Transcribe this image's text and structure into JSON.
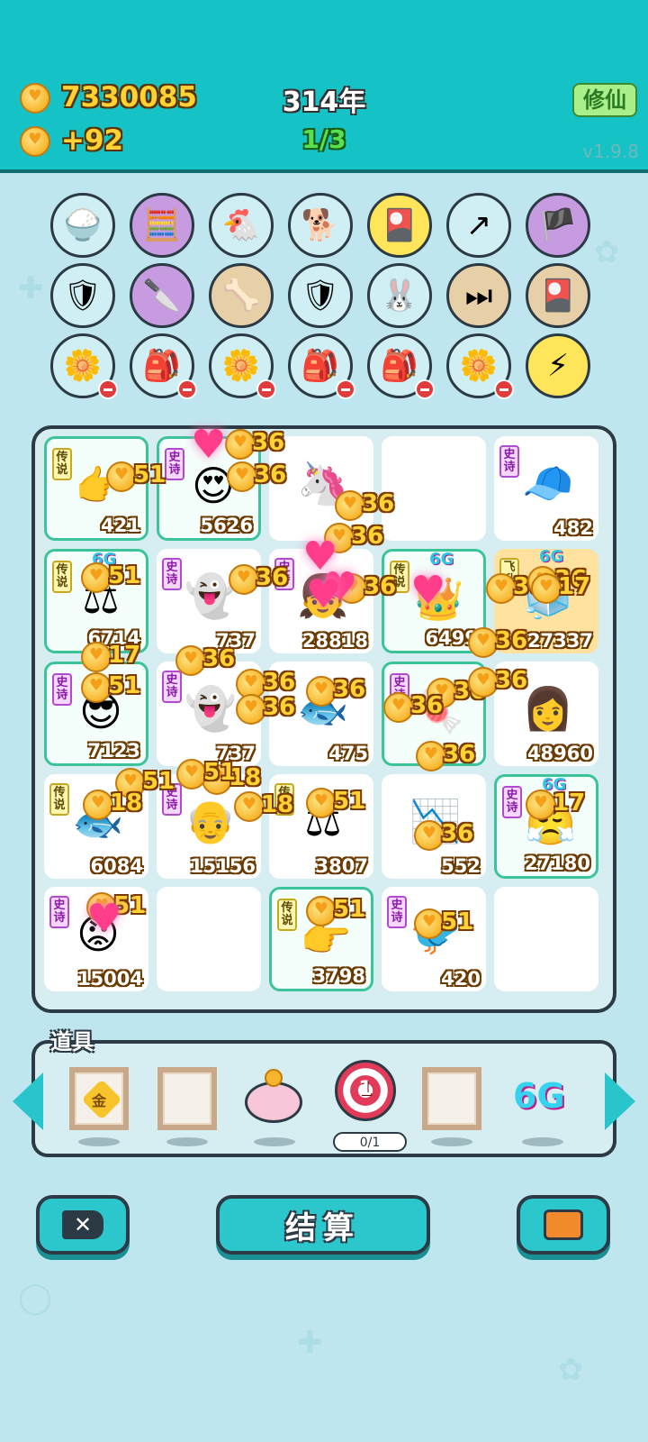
{
  "header": {
    "coins": "7330085",
    "income": "+92",
    "year": "314年",
    "round": "1/3",
    "mode_label": "修仙",
    "version": "v1.9.8"
  },
  "relics": [
    {
      "icon": "rice-bowl-icon",
      "glyph": "🍚"
    },
    {
      "icon": "math-kid-icon",
      "glyph": "🧮"
    },
    {
      "icon": "hen-egg-icon",
      "glyph": "🐔"
    },
    {
      "icon": "cool-dog-icon",
      "glyph": "🐕"
    },
    {
      "icon": "card-pack-icon",
      "glyph": "🎴"
    },
    {
      "icon": "arrow-card-icon",
      "glyph": "↗"
    },
    {
      "icon": "eye-patch-icon",
      "glyph": "🏴"
    },
    {
      "icon": "shield-wrench-icon",
      "glyph": "🛡"
    },
    {
      "icon": "cleaver-icon",
      "glyph": "🔪"
    },
    {
      "icon": "pet-bowl-icon",
      "glyph": "🦴"
    },
    {
      "icon": "shield-wrench-icon",
      "glyph": "🛡"
    },
    {
      "icon": "rabbit-icon",
      "glyph": "🐰"
    },
    {
      "icon": "skip-icon",
      "glyph": "⏭"
    },
    {
      "icon": "card-pack-icon",
      "glyph": "🎴"
    },
    {
      "icon": "flower-pot-icon",
      "glyph": "🌼"
    },
    {
      "icon": "seed-bag-icon",
      "glyph": "🎒"
    },
    {
      "icon": "flower-pot-icon",
      "glyph": "🌼"
    },
    {
      "icon": "seed-bag-icon",
      "glyph": "🎒"
    },
    {
      "icon": "seed-bag-icon",
      "glyph": "🎒"
    },
    {
      "icon": "flower-pot-icon",
      "glyph": "🌼"
    },
    {
      "icon": "lightning-icon",
      "glyph": "⚡"
    }
  ],
  "board": [
    {
      "tag": "传说",
      "tagType": "legend",
      "art": "👉",
      "value": "421",
      "rare": true
    },
    {
      "tag": "史诗",
      "tagType": "epic",
      "art": "😍",
      "value": "5626",
      "rare": true
    },
    {
      "tag": "",
      "tagType": "",
      "art": "🦄",
      "value": "",
      "rare": false
    },
    {
      "tag": "",
      "tagType": "",
      "art": "",
      "value": "",
      "rare": false
    },
    {
      "tag": "史诗",
      "tagType": "epic",
      "art": "🧢",
      "value": "482",
      "rare": false
    },
    {
      "tag": "传说",
      "tagType": "legend",
      "art": "⚖",
      "value": "6714",
      "rare": true,
      "sixg": true
    },
    {
      "tag": "史诗",
      "tagType": "epic",
      "art": "👻",
      "value": "737",
      "rare": false
    },
    {
      "tag": "史诗",
      "tagType": "epic",
      "art": "👧",
      "value": "28818",
      "rare": false
    },
    {
      "tag": "传说",
      "tagType": "legend",
      "art": "👑",
      "value": "6499",
      "rare": true,
      "sixg": true
    },
    {
      "tag": "飞升",
      "tagType": "legend",
      "art": "🧊",
      "value": "27337",
      "gold": true,
      "sixg": true
    },
    {
      "tag": "史诗",
      "tagType": "epic",
      "art": "😎",
      "value": "7123",
      "rare": true
    },
    {
      "tag": "史诗",
      "tagType": "epic",
      "art": "👻",
      "value": "737",
      "rare": false
    },
    {
      "tag": "",
      "tagType": "",
      "art": "🐟",
      "value": "475",
      "rare": false
    },
    {
      "tag": "史诗",
      "tagType": "epic",
      "art": "🍬",
      "value": "",
      "rare": true
    },
    {
      "tag": "",
      "tagType": "",
      "art": "👩",
      "value": "48960",
      "rare": false
    },
    {
      "tag": "传说",
      "tagType": "legend",
      "art": "🐟",
      "value": "6084",
      "rare": false
    },
    {
      "tag": "史诗",
      "tagType": "epic",
      "art": "👴",
      "value": "15156",
      "rare": false
    },
    {
      "tag": "传说",
      "tagType": "legend",
      "art": "⚖",
      "value": "3807",
      "rare": false
    },
    {
      "tag": "",
      "tagType": "",
      "art": "📉",
      "value": "552",
      "rare": false
    },
    {
      "tag": "史诗",
      "tagType": "epic",
      "art": "😤",
      "value": "27180",
      "rare": true,
      "sixg": true
    },
    {
      "tag": "史诗",
      "tagType": "epic",
      "art": "😡",
      "value": "15004",
      "rare": false
    },
    {
      "tag": "",
      "tagType": "",
      "art": "",
      "value": "",
      "rare": false
    },
    {
      "tag": "传说",
      "tagType": "legend",
      "art": "👉",
      "value": "3798",
      "rare": true
    },
    {
      "tag": "史诗",
      "tagType": "epic",
      "art": "🐦",
      "value": "420",
      "rare": false
    },
    {
      "tag": "",
      "tagType": "",
      "art": "",
      "value": "",
      "rare": false
    }
  ],
  "effects": [
    "51",
    "36",
    "36",
    "36",
    "36",
    "51",
    "36",
    "36",
    "36",
    "36",
    "17",
    "36",
    "51",
    "36",
    "36",
    "36",
    "36",
    "36",
    "51",
    "18",
    "18",
    "51",
    "36",
    "17",
    "51",
    "51",
    "51",
    "51",
    "36",
    "18",
    "17",
    "36",
    "36"
  ],
  "items": {
    "title": "道具",
    "gold_label": "金",
    "target_label": "1",
    "target_counter": "0/1",
    "sixg_label": "6G"
  },
  "buttons": {
    "settle": "结算"
  },
  "colors": {
    "header": "#15c3c6",
    "background": "#bfe6ee",
    "accent": "#2bc7cc",
    "coin": "#f7b52b"
  }
}
